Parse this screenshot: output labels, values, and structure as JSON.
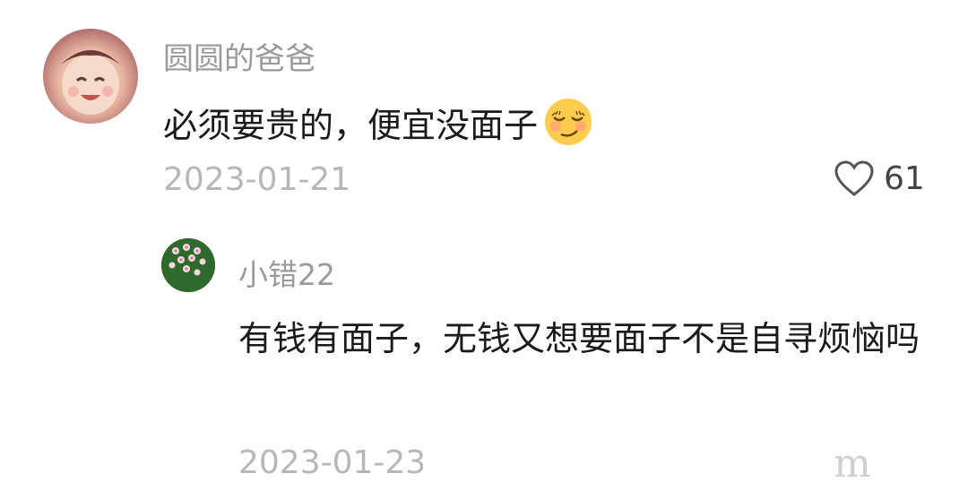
{
  "comments": [
    {
      "username": "圆圆的爸爸",
      "text": "必须要贵的，便宜没面子",
      "emoji": "smirk-emoji",
      "date": "2023-01-21",
      "likes": "61"
    },
    {
      "username": "小错22",
      "text": "有钱有面子，无钱又想要面子不是自寻烦恼吗",
      "date": "2023-01-23"
    }
  ],
  "icons": {
    "like": "heart-outline-icon",
    "watermark": "brand-watermark-icon"
  },
  "colors": {
    "username": "#9a9a9a",
    "date": "#b7b7b7",
    "text": "#1a1a1a"
  }
}
